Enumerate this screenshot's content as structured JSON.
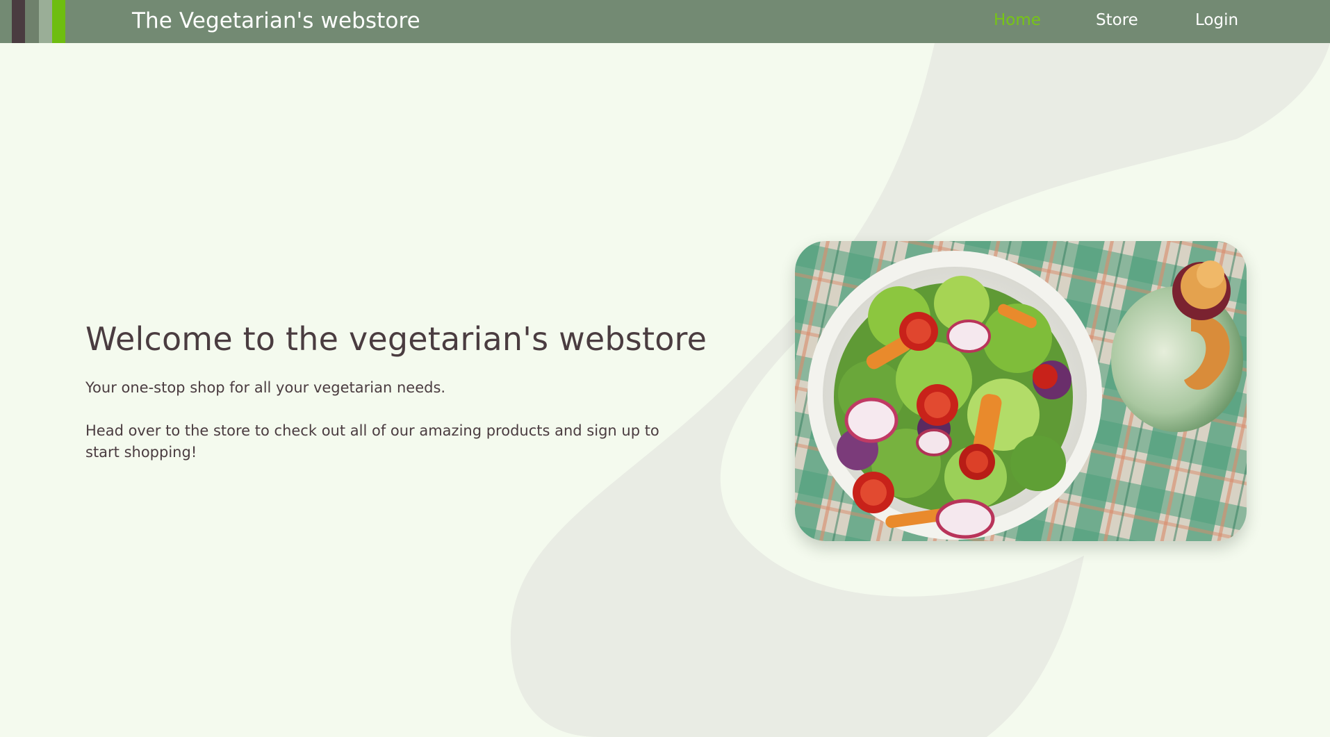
{
  "nav": {
    "brand": "The Vegetarian's webstore",
    "links": [
      {
        "label": "Home",
        "active": true
      },
      {
        "label": "Store",
        "active": false
      },
      {
        "label": "Login",
        "active": false
      }
    ]
  },
  "hero": {
    "title": "Welcome to the vegetarian's webstore",
    "paragraphs": [
      "Your one-stop shop for all your vegetarian needs.",
      "Head over to the store to check out all of our amazing products and sign up to start shopping!"
    ]
  },
  "colors": {
    "navbar": "#738a73",
    "accent_active": "#77c516",
    "text_dark": "#4a3c40",
    "background": "#f4faee",
    "blob": "#e9ece4"
  }
}
